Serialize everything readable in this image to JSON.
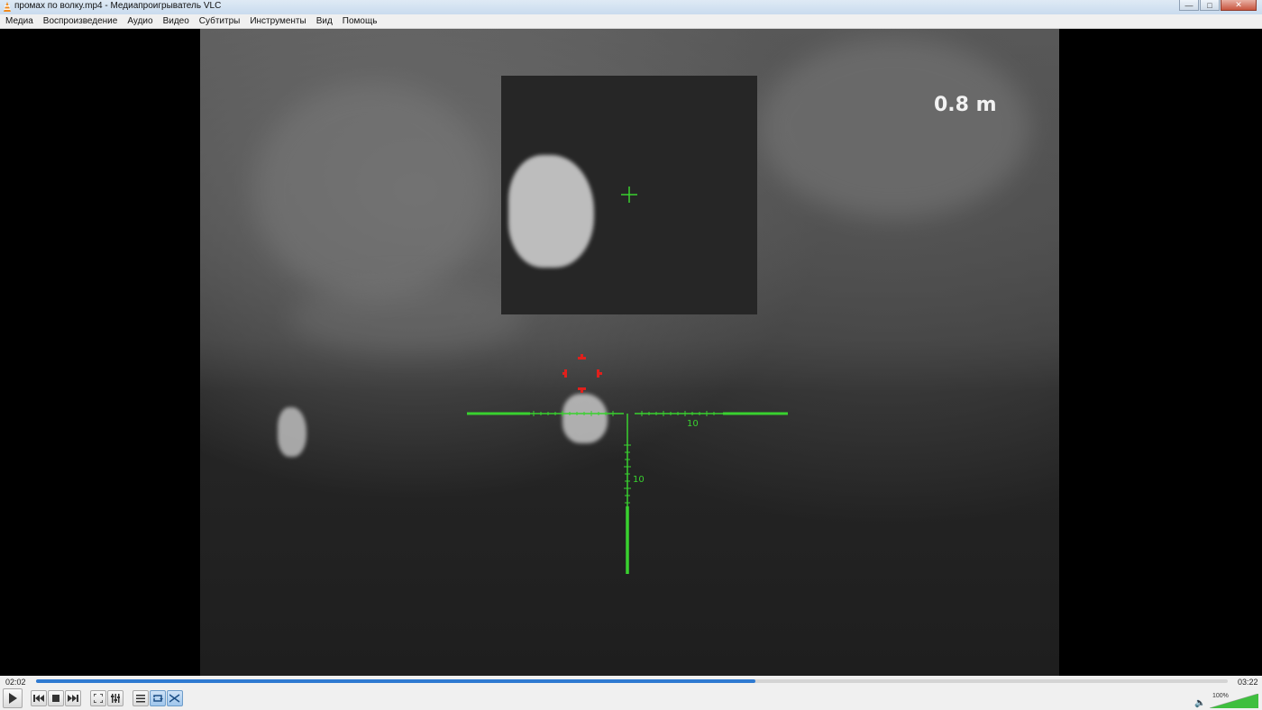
{
  "window": {
    "title": "промах по волку.mp4 - Медиапроигрыватель VLC",
    "app_icon": "vlc-cone-icon",
    "buttons": [
      "minimize-icon",
      "maximize-icon",
      "close-icon"
    ]
  },
  "menu": {
    "items": [
      "Медиа",
      "Воспроизведение",
      "Аудио",
      "Видео",
      "Субтитры",
      "Инструменты",
      "Вид",
      "Помощь"
    ]
  },
  "video": {
    "range_readout": "0.8 m",
    "reticle_label_horizontal": "10",
    "reticle_label_vertical": "10",
    "reticle_color": "#39d12f",
    "aim_marker_color": "#e0201c"
  },
  "controls": {
    "elapsed": "02:02",
    "total": "03:22",
    "progress_fraction": 0.604,
    "volume": "100%",
    "volume_fraction": 1.0,
    "accent": "#2f7ad1",
    "buttons": [
      "play-icon",
      "previous-icon",
      "stop-icon",
      "next-icon",
      "fullscreen-icon",
      "extended-settings-icon",
      "playlist-icon",
      "loop-icon",
      "random-icon"
    ]
  }
}
